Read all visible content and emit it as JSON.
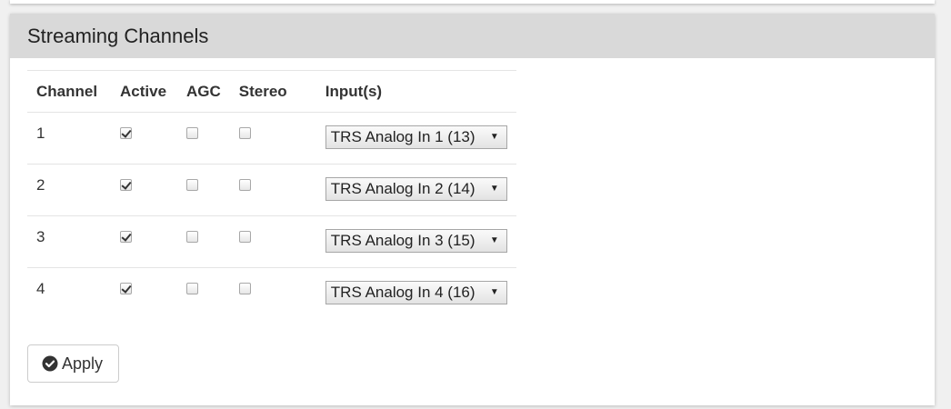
{
  "panel": {
    "title": "Streaming Channels"
  },
  "table": {
    "headers": {
      "channel": "Channel",
      "active": "Active",
      "agc": "AGC",
      "stereo": "Stereo",
      "inputs": "Input(s)"
    },
    "rows": [
      {
        "channel": "1",
        "active": true,
        "agc": false,
        "stereo": false,
        "input": "TRS Analog In 1 (13)"
      },
      {
        "channel": "2",
        "active": true,
        "agc": false,
        "stereo": false,
        "input": "TRS Analog In 2 (14)"
      },
      {
        "channel": "3",
        "active": true,
        "agc": false,
        "stereo": false,
        "input": "TRS Analog In 3 (15)"
      },
      {
        "channel": "4",
        "active": true,
        "agc": false,
        "stereo": false,
        "input": "TRS Analog In 4 (16)"
      }
    ]
  },
  "actions": {
    "apply_label": "Apply",
    "apply_icon": "check-circle-icon"
  }
}
